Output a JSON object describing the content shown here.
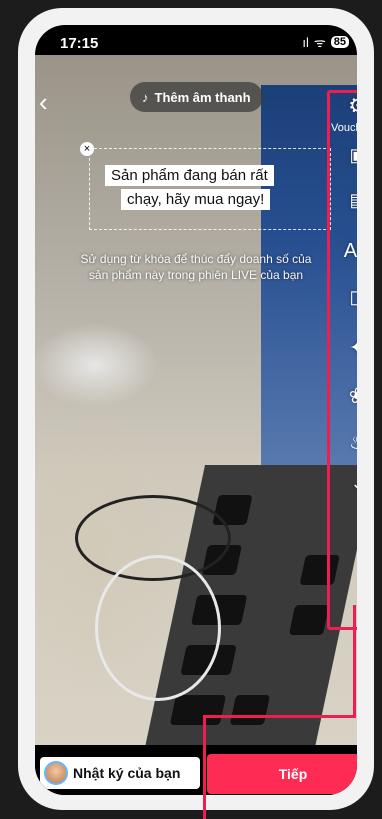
{
  "status_bar": {
    "time": "17:15",
    "signal": "ıl",
    "wifi": "ᯤ",
    "battery": "85"
  },
  "header": {
    "sound_label": "Thêm âm thanh",
    "sound_icon": "music-note-icon"
  },
  "text_sticker": {
    "line1": "Sản phẩm đang bán rất",
    "line2": "chạy, hãy mua ngay!"
  },
  "caption": "Sử dụng từ khóa để thúc đẩy doanh số của sản phẩm này trong phiên LIVE của bạn",
  "toolbar": {
    "highlight_color": "#ee1d52",
    "labels": [
      "Vouche"
    ],
    "icons": [
      "settings-icon",
      "voucher-icon",
      "live-icon",
      "text-icon",
      "sticker-icon",
      "effects-icon",
      "filters-icon",
      "voice-icon",
      "chevron-down-icon"
    ]
  },
  "bottom": {
    "journal_label": "Nhật ký của bạn",
    "next_label": "Tiếp",
    "next_color": "#fe2c55"
  }
}
